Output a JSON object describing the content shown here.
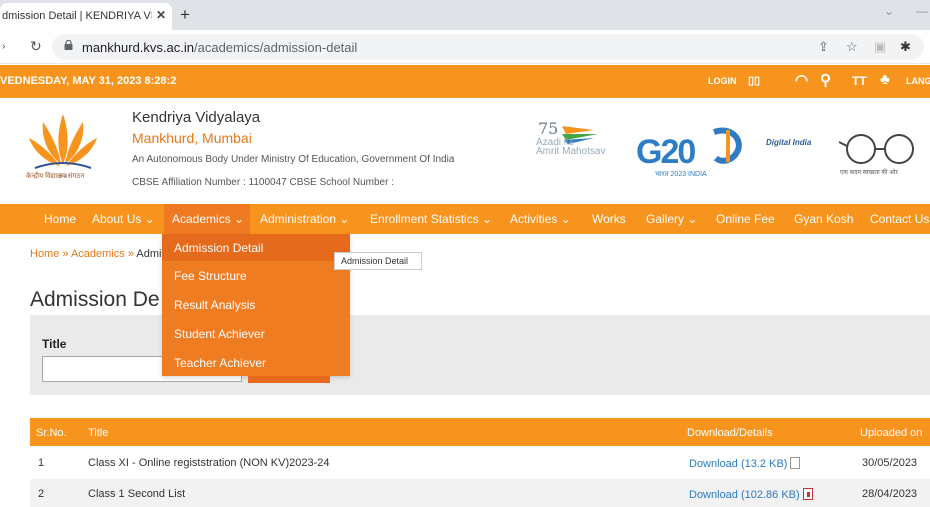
{
  "browser": {
    "tab_title": "dmission Detail | KENDRIYA VID",
    "tab_close": "✕",
    "new_tab": "+",
    "url_host": "mankhurd.kvs.ac.in",
    "url_path": "/academics/admission-detail"
  },
  "topbar": {
    "datetime": "VEDNESDAY, MAY 31, 2023 8:28:2",
    "login": "LOGIN",
    "lang": "LANG",
    "text_size_icon": "TT"
  },
  "header": {
    "logo_caption": "केन्द्रीय विद्यालय संगठन",
    "title": "Kendriya Vidyalaya",
    "place": "Mankhurd, Mumbai",
    "line1": "An Autonomous Body Under Ministry Of Education, Government Of India",
    "line2": "CBSE Affiliation Number : 1100047 CBSE School Number :",
    "azadi": "Azadi Ka\nAmrit Mahotsav",
    "g20": "G20",
    "g20_sub": "भारत 2023 INDIA",
    "digital_india": "Digital India",
    "swachh_caption": "एक कदम स्वच्छता की ओर"
  },
  "nav": {
    "items": [
      "Home",
      "About Us",
      "Academics",
      "Administration",
      "Enrollment Statistics",
      "Activities",
      "Works",
      "Gallery",
      "Online Fee",
      "Gyan Kosh",
      "Contact Us"
    ],
    "chevron": "⌄"
  },
  "dropdown": {
    "items": [
      "Admission Detail",
      "Fee Structure",
      "Result Analysis",
      "Student Achiever",
      "Teacher Achiever"
    ],
    "tooltip": "Admission Detail"
  },
  "breadcrumb": {
    "home": "Home",
    "sep": " » ",
    "academics": "Academics",
    "current": "Admi"
  },
  "page": {
    "title": "Admission De",
    "filter_label": "Title"
  },
  "table": {
    "headers": [
      "Sr.No.",
      "Title",
      "Download/Details",
      "Uploaded on"
    ],
    "rows": [
      {
        "sr": "1",
        "title": "Class XI - Online registstration (NON KV)2023-24",
        "download": "Download (13.2 KB)",
        "date": "30/05/2023"
      },
      {
        "sr": "2",
        "title": "Class 1 Second List",
        "download": "Download (102.86 KB)",
        "date": "28/04/2023"
      }
    ]
  },
  "colors": {
    "accent": "#f7941d",
    "dropdown": "#f07c21",
    "link": "#2b7bc2"
  }
}
